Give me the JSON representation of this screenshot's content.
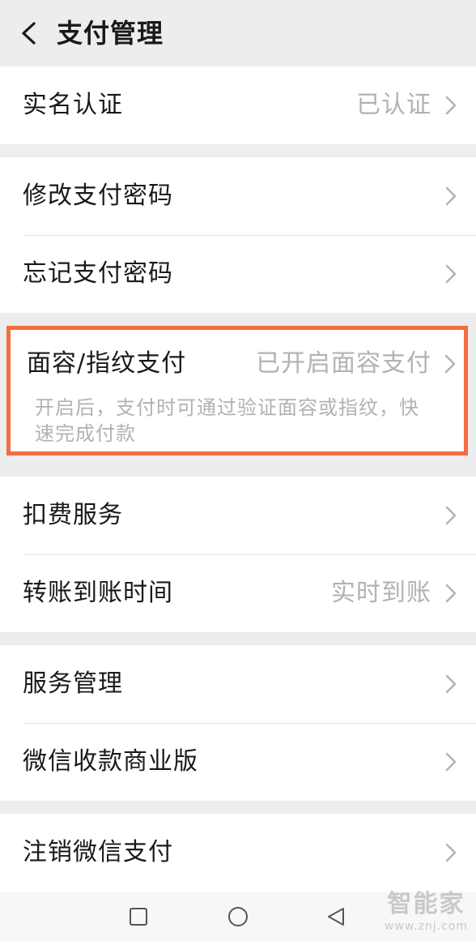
{
  "header": {
    "title": "支付管理"
  },
  "groups": {
    "verify": {
      "label": "实名认证",
      "value": "已认证"
    },
    "password": {
      "change_label": "修改支付密码",
      "forgot_label": "忘记支付密码"
    },
    "face_pay": {
      "label": "面容/指纹支付",
      "value": "已开启面容支付",
      "description": "开启后，支付时可通过验证面容或指纹，快速完成付款"
    },
    "services": {
      "deduct_label": "扣费服务",
      "transfer_label": "转账到账时间",
      "transfer_value": "实时到账"
    },
    "manage": {
      "service_label": "服务管理",
      "business_label": "微信收款商业版"
    },
    "cancel": {
      "label": "注销微信支付"
    }
  },
  "watermark": {
    "main": "智能家",
    "sub": "www.znj.com"
  },
  "colors": {
    "highlight": "#f26d41",
    "background": "#ededed",
    "secondary_text": "#b2b2b2"
  }
}
